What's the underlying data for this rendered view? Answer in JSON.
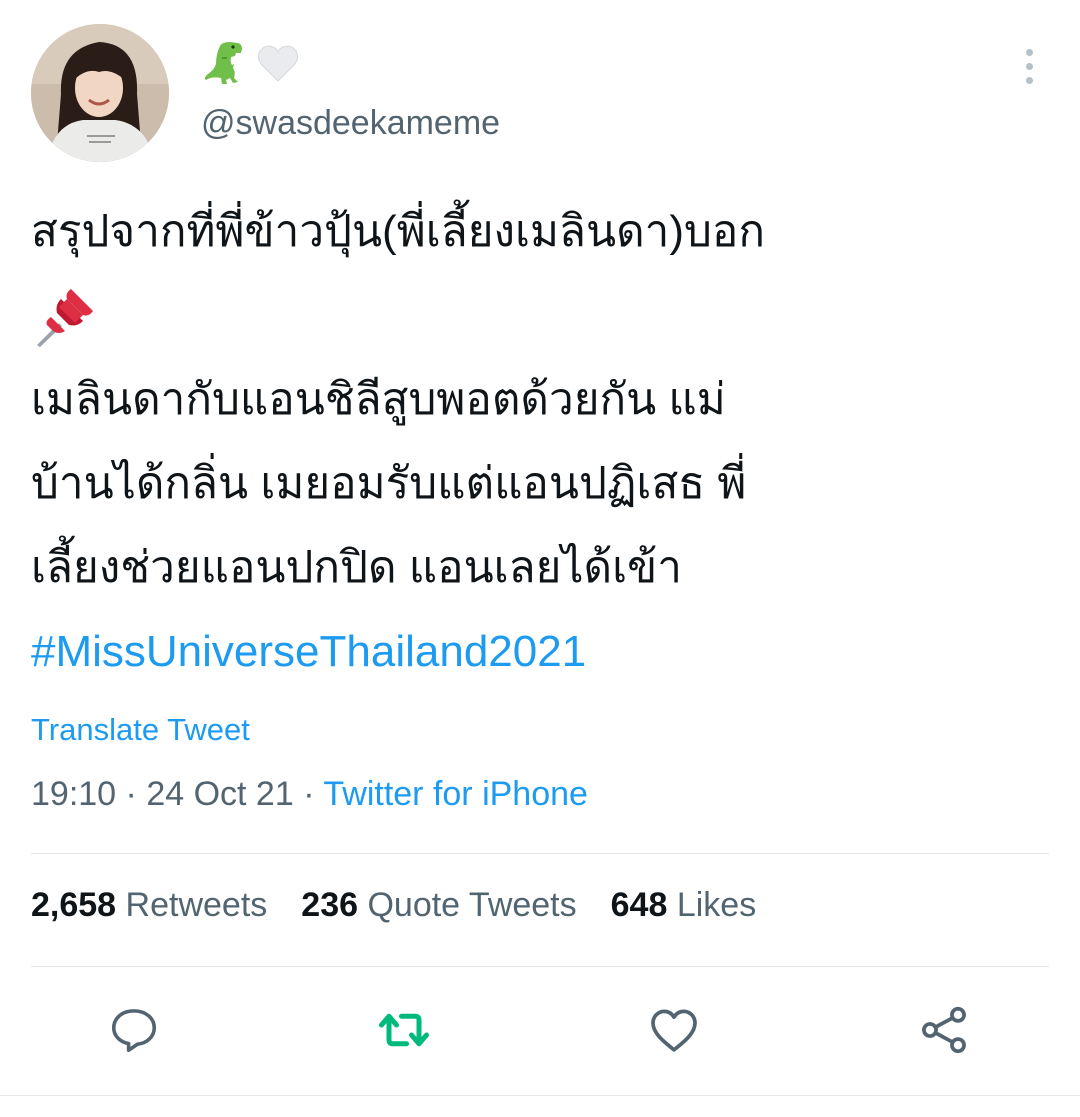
{
  "tweet": {
    "author": {
      "avatar_icon": "profile-photo",
      "display_icons": [
        "dinosaur-emoji",
        "white-heart-emoji"
      ],
      "handle": "@swasdeekameme"
    },
    "more_icon": "vertical-ellipsis-icon",
    "text_lines": [
      "สรุปจากที่พี่ข้าวปุ้น(พี่เลี้ยงเมลินดา)บอก",
      "เมลินดากับแอนชิลีสูบพอตด้วยกัน แม่",
      "บ้านได้กลิ่น เมยอมรับแต่แอนปฏิเสธ พี่",
      "เลี้ยงช่วยแอนปกปิด แอนเลยได้เข้า"
    ],
    "pin_icon": "pushpin-emoji",
    "hashtag": "#MissUniverseThailand2021",
    "translate_label": "Translate Tweet",
    "time": "19:10",
    "date": "24 Oct 21",
    "separator": "·",
    "source": "Twitter for iPhone"
  },
  "stats": {
    "retweets_count": "2,658",
    "retweets_label": "Retweets",
    "quotes_count": "236",
    "quotes_label": "Quote Tweets",
    "likes_count": "648",
    "likes_label": "Likes"
  },
  "actions": {
    "reply_icon": "reply-icon",
    "retweet_icon": "retweet-icon",
    "like_icon": "heart-icon",
    "share_icon": "share-icon"
  },
  "colors": {
    "link": "#1d9bf0",
    "secondary_text": "#536471",
    "retweet_green": "#00ba7c",
    "divider": "#e3e7ea"
  }
}
